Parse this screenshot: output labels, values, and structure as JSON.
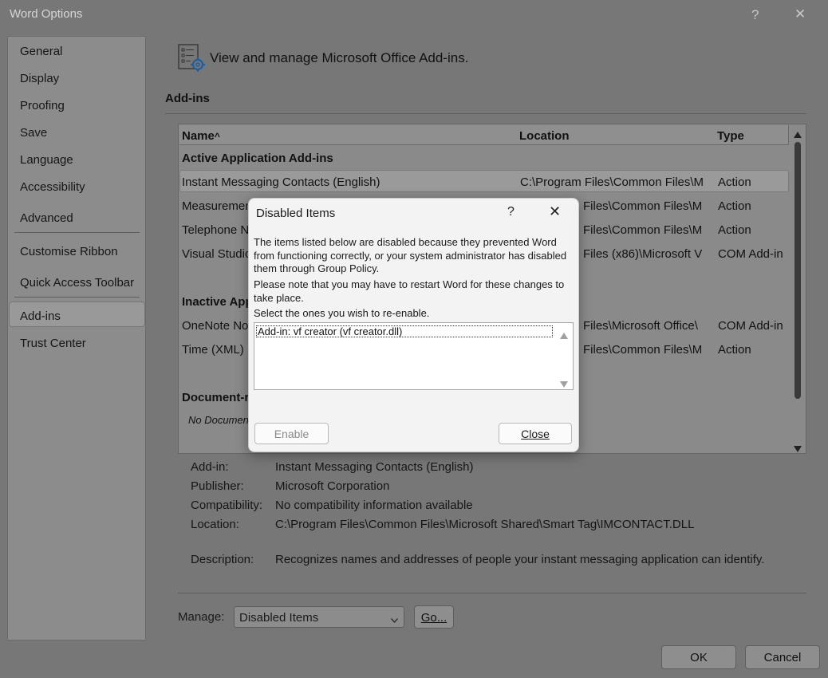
{
  "window": {
    "title": "Word Options",
    "help": "?",
    "close": "✕"
  },
  "sidebar": {
    "items": [
      {
        "label": "General"
      },
      {
        "label": "Display"
      },
      {
        "label": "Proofing"
      },
      {
        "label": "Save"
      },
      {
        "label": "Language"
      },
      {
        "label": "Accessibility"
      },
      {
        "label": "Advanced"
      },
      {
        "label": "Customise Ribbon"
      },
      {
        "label": "Quick Access Toolbar"
      },
      {
        "label": "Add-ins"
      },
      {
        "label": "Trust Center"
      }
    ],
    "selected": "Add-ins"
  },
  "main": {
    "header": "View and manage Microsoft Office Add-ins.",
    "section": "Add-ins",
    "table": {
      "columns": [
        "Name",
        "Location",
        "Type"
      ],
      "sort_indicator": "^",
      "groups": {
        "active": "Active Application Add-ins",
        "inactive": "Inactive Appl",
        "document": "Document-r"
      },
      "rows": [
        [
          "Instant Messaging Contacts (English)",
          "C:\\Program Files\\Common Files\\M",
          "Action"
        ],
        [
          "Measuremen",
          "Files\\Common Files\\M",
          "Action"
        ],
        [
          "Telephone N",
          "Files\\Common Files\\M",
          "Action"
        ],
        [
          "Visual Studic",
          "Files (x86)\\Microsoft V",
          "COM Add-in"
        ],
        [
          "OneNote No",
          "Files\\Microsoft Office\\",
          "COM Add-in"
        ],
        [
          "Time (XML)",
          "Files\\Common Files\\M",
          "Action"
        ]
      ],
      "no_docs": "No Documen"
    },
    "details": {
      "addin_label": "Add-in:",
      "addin": "Instant Messaging Contacts (English)",
      "publisher_label": "Publisher:",
      "publisher": "Microsoft Corporation",
      "compat_label": "Compatibility:",
      "compat": "No compatibility information available",
      "location_label": "Location:",
      "location": "C:\\Program Files\\Common Files\\Microsoft Shared\\Smart Tag\\IMCONTACT.DLL",
      "desc_label": "Description:",
      "desc": "Recognizes names and addresses of people your instant messaging application can identify."
    },
    "manage": {
      "label": "Manage:",
      "value": "Disabled Items",
      "go": "Go..."
    },
    "ok": "OK",
    "cancel": "Cancel"
  },
  "dialog": {
    "title": "Disabled Items",
    "help": "?",
    "close": "✕",
    "p1": "The items listed below are disabled because they prevented Word from functioning correctly, or your system administrator has disabled them through Group Policy.",
    "p2": "Please note that you may have to restart Word for these changes to take place.",
    "p3": "Select the ones you wish to re-enable.",
    "items": [
      "Add-in: vf creator (vf creator.dll)"
    ],
    "enable": "Enable",
    "close_btn": "Close"
  }
}
